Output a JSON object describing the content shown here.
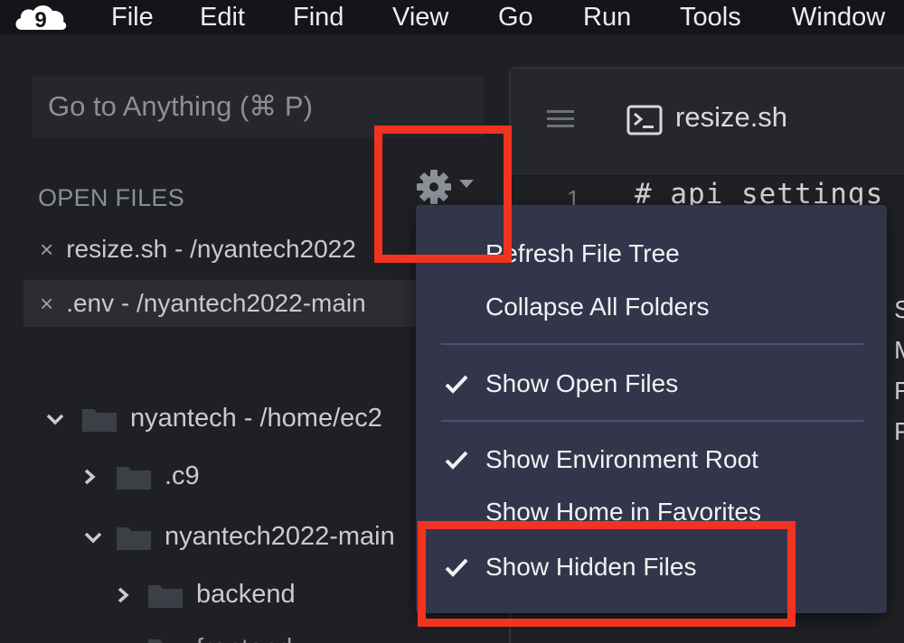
{
  "menubar": {
    "logo_text": "9",
    "items": [
      "File",
      "Edit",
      "Find",
      "View",
      "Go",
      "Run",
      "Tools",
      "Window"
    ]
  },
  "sidebar": {
    "goto_placeholder": "Go to Anything (⌘ P)",
    "open_files_title": "OPEN FILES",
    "open_files": [
      {
        "close": "×",
        "label": "resize.sh - /nyantech2022"
      },
      {
        "close": "×",
        "label": ".env - /nyantech2022-main"
      }
    ],
    "tree": [
      {
        "arrow": "⌄",
        "label": "nyantech - /home/ec2"
      },
      {
        "arrow": "›",
        "label": ".c9"
      },
      {
        "arrow": "⌄",
        "label": "nyantech2022-main"
      },
      {
        "arrow": "›",
        "label": "backend"
      },
      {
        "arrow": "›",
        "label": "frontend"
      }
    ]
  },
  "editor": {
    "tab_title": "resize.sh",
    "line_number": "1",
    "code_line": "# api_settings",
    "line_fragments": [
      "S",
      "M",
      "R",
      "P"
    ]
  },
  "dropdown": {
    "items": [
      {
        "label": "Refresh File Tree",
        "checked": false
      },
      {
        "label": "Collapse All Folders",
        "checked": false
      },
      {
        "label": "Show Open Files",
        "checked": true
      },
      {
        "label": "Show Environment Root",
        "checked": true
      },
      {
        "label": "Show Home in Favorites",
        "checked": false
      },
      {
        "label": "Show Hidden Files",
        "checked": true
      }
    ]
  },
  "colors": {
    "highlight": "#f23320",
    "menu_bg": "#33354a",
    "separator": "#4c5074"
  }
}
